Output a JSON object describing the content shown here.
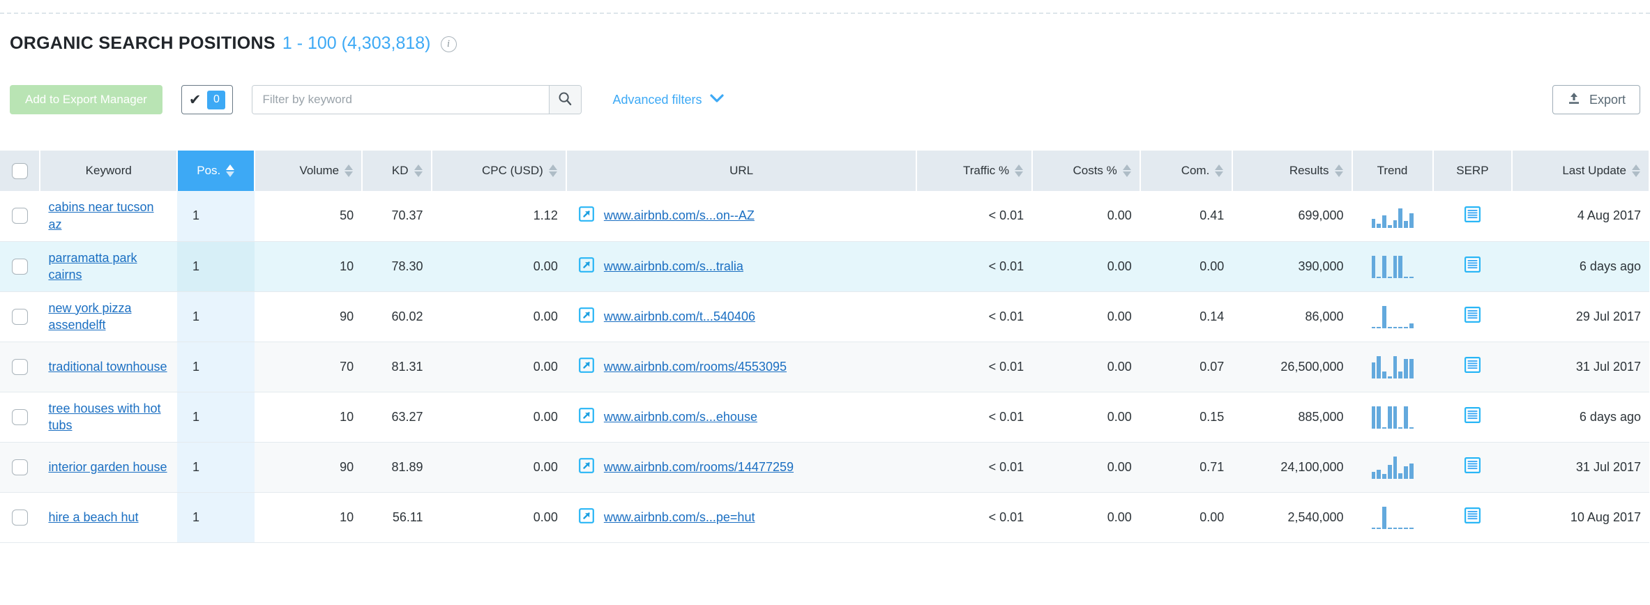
{
  "header": {
    "title": "ORGANIC SEARCH POSITIONS",
    "range_count": "1 - 100 (4,303,818)",
    "info_icon": "info-icon"
  },
  "toolbar": {
    "export_manager_label": "Add to Export Manager",
    "selected_count": "0",
    "check_glyph": "✔",
    "filter_placeholder": "Filter by keyword",
    "filter_value": "",
    "search_icon": "search-icon",
    "advanced_filters_label": "Advanced filters",
    "chevron": "❯",
    "export_label": "Export",
    "export_icon": "upload-icon"
  },
  "table": {
    "columns": [
      {
        "key": "checkbox",
        "label": "",
        "sortable": false,
        "align": "center"
      },
      {
        "key": "keyword",
        "label": "Keyword",
        "sortable": false,
        "align": "center"
      },
      {
        "key": "pos",
        "label": "Pos.",
        "sortable": true,
        "align": "center",
        "sorted": true
      },
      {
        "key": "volume",
        "label": "Volume",
        "sortable": true,
        "align": "right"
      },
      {
        "key": "kd",
        "label": "KD",
        "sortable": true,
        "align": "right"
      },
      {
        "key": "cpc",
        "label": "CPC (USD)",
        "sortable": true,
        "align": "right"
      },
      {
        "key": "url",
        "label": "URL",
        "sortable": false,
        "align": "center"
      },
      {
        "key": "traffic",
        "label": "Traffic %",
        "sortable": true,
        "align": "right"
      },
      {
        "key": "costs",
        "label": "Costs %",
        "sortable": true,
        "align": "right"
      },
      {
        "key": "com",
        "label": "Com.",
        "sortable": true,
        "align": "right"
      },
      {
        "key": "results",
        "label": "Results",
        "sortable": true,
        "align": "right"
      },
      {
        "key": "trend",
        "label": "Trend",
        "sortable": false,
        "align": "center"
      },
      {
        "key": "serp",
        "label": "SERP",
        "sortable": false,
        "align": "center"
      },
      {
        "key": "last",
        "label": "Last Update",
        "sortable": true,
        "align": "right"
      }
    ],
    "rows": [
      {
        "checked": false,
        "keyword": "cabins near tucson az",
        "pos": "1",
        "volume": "50",
        "kd": "70.37",
        "cpc": "1.12",
        "url": "www.airbnb.com/s...on--AZ",
        "traffic": "< 0.01",
        "costs": "0.00",
        "com": "0.41",
        "results": "699,000",
        "trend": [
          42,
          20,
          55,
          12,
          34,
          86,
          30,
          66
        ],
        "serp_icon": "serp-list-icon",
        "last_update": "4 Aug 2017",
        "stripe": "white"
      },
      {
        "checked": false,
        "keyword": "parramatta park cairns",
        "pos": "1",
        "volume": "10",
        "kd": "78.30",
        "cpc": "0.00",
        "url": "www.airbnb.com/s...tralia",
        "traffic": "< 0.01",
        "costs": "0.00",
        "com": "0.00",
        "results": "390,000",
        "trend": [
          100,
          0,
          100,
          0,
          100,
          100,
          0,
          0
        ],
        "serp_icon": "serp-list-icon",
        "last_update": "6 days ago",
        "stripe": "highlight"
      },
      {
        "checked": false,
        "keyword": "new york pizza assendelft",
        "pos": "1",
        "volume": "90",
        "kd": "60.02",
        "cpc": "0.00",
        "url": "www.airbnb.com/t...540406",
        "traffic": "< 0.01",
        "costs": "0.00",
        "com": "0.14",
        "results": "86,000",
        "trend": [
          6,
          6,
          100,
          6,
          6,
          6,
          6,
          22
        ],
        "serp_icon": "serp-list-icon",
        "last_update": "29 Jul 2017",
        "stripe": "white"
      },
      {
        "checked": false,
        "keyword": "traditional townhouse",
        "pos": "1",
        "volume": "70",
        "kd": "81.31",
        "cpc": "0.00",
        "url": "www.airbnb.com/rooms/4553095",
        "traffic": "< 0.01",
        "costs": "0.00",
        "com": "0.07",
        "results": "26,500,000",
        "trend": [
          72,
          100,
          30,
          10,
          100,
          30,
          86,
          86
        ],
        "serp_icon": "serp-list-icon",
        "last_update": "31 Jul 2017",
        "stripe": "alt"
      },
      {
        "checked": false,
        "keyword": "tree houses with hot tubs",
        "pos": "1",
        "volume": "10",
        "kd": "63.27",
        "cpc": "0.00",
        "url": "www.airbnb.com/s...ehouse",
        "traffic": "< 0.01",
        "costs": "0.00",
        "com": "0.15",
        "results": "885,000",
        "trend": [
          100,
          100,
          0,
          100,
          100,
          0,
          100,
          0
        ],
        "serp_icon": "serp-list-icon",
        "last_update": "6 days ago",
        "stripe": "white"
      },
      {
        "checked": false,
        "keyword": "interior garden house",
        "pos": "1",
        "volume": "90",
        "kd": "81.89",
        "cpc": "0.00",
        "url": "www.airbnb.com/rooms/14477259",
        "traffic": "< 0.01",
        "costs": "0.00",
        "com": "0.71",
        "results": "24,100,000",
        "trend": [
          30,
          42,
          22,
          62,
          100,
          26,
          56,
          70
        ],
        "serp_icon": "serp-list-icon",
        "last_update": "31 Jul 2017",
        "stripe": "alt"
      },
      {
        "checked": false,
        "keyword": "hire a beach hut",
        "pos": "1",
        "volume": "10",
        "kd": "56.11",
        "cpc": "0.00",
        "url": "www.airbnb.com/s...pe=hut",
        "traffic": "< 0.01",
        "costs": "0.00",
        "com": "0.00",
        "results": "2,540,000",
        "trend": [
          0,
          0,
          100,
          0,
          0,
          0,
          0,
          0
        ],
        "serp_icon": "serp-list-icon",
        "last_update": "10 Aug 2017",
        "stripe": "white"
      }
    ]
  },
  "colors": {
    "accent_blue": "#3da9f5",
    "link_blue": "#1b6fc2",
    "header_bg": "#e3eaf0",
    "highlight_row": "#e5f6fb",
    "pos_column": "#e8f4fd",
    "green_button": "#b9e4b4",
    "spark_bar": "#63a9dd"
  }
}
